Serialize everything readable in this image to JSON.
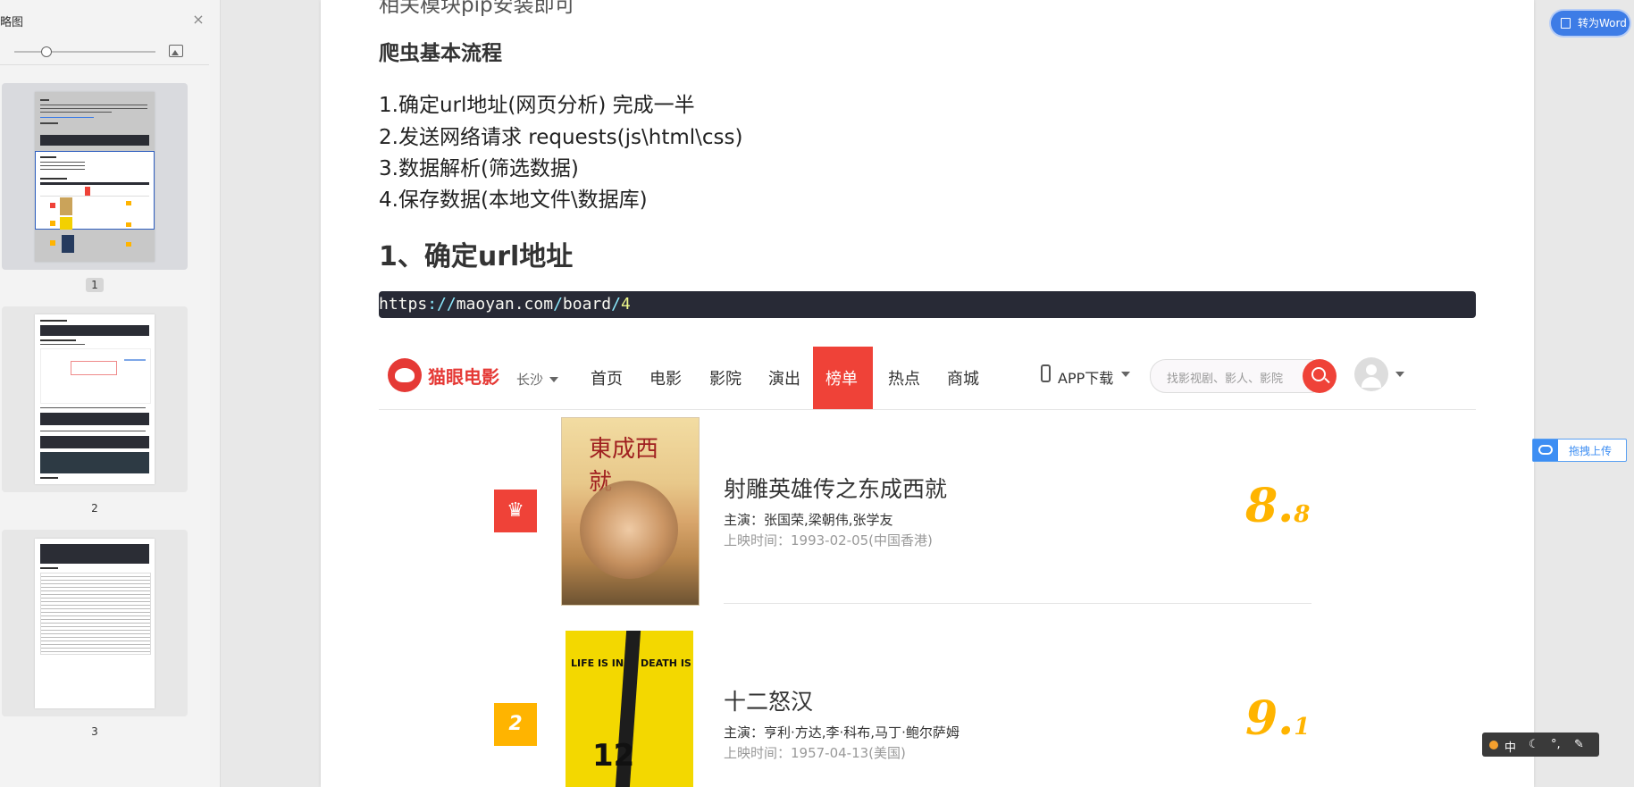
{
  "sidebar": {
    "title": "略图",
    "close_icon": "close-icon",
    "pages": [
      {
        "number": "1",
        "active": true
      },
      {
        "number": "2",
        "active": false
      },
      {
        "number": "3",
        "active": false
      }
    ]
  },
  "document": {
    "cutoff_text": "相关模块pip安装即可",
    "flow_heading": "爬虫基本流程",
    "steps": [
      "1.确定url地址(网页分析) 完成一半",
      "2.发送网络请求 requests(js\\html\\css)",
      "3.数据解析(筛选数据)",
      "4.保存数据(本地文件\\数据库)"
    ],
    "section_heading": "1、确定url地址",
    "code_url": {
      "scheme": "https",
      "sep1": "://",
      "host": "maoyan.com",
      "sep2": "/",
      "path": "board",
      "sep3": "/",
      "num": "4"
    }
  },
  "maoyan": {
    "brand": "猫眼电影",
    "city": "长沙",
    "nav": [
      "首页",
      "电影",
      "影院",
      "演出",
      "榜单",
      "热点",
      "商城"
    ],
    "active_nav": "榜单",
    "app_download": "APP下载",
    "search_placeholder": "找影视剧、影人、影院",
    "movies": [
      {
        "rank": "♛",
        "rank_color": "#ef4238",
        "title": "射雕英雄传之东成西就",
        "stars": "主演：张国荣,梁朝伟,张学友",
        "release": "上映时间：1993-02-05(中国香港)",
        "score_int": "8.",
        "score_dec": "8"
      },
      {
        "rank": "2",
        "rank_color": "#ffb400",
        "title": "十二怒汉",
        "stars": "主演：亨利·方达,李·科布,马丁·鲍尔萨姆",
        "release": "上映时间：1957-04-13(美国)",
        "score_int": "9.",
        "score_dec": "1"
      }
    ]
  },
  "toolbar": {
    "to_word": "转为Word",
    "drag_upload": "拖拽上传"
  },
  "ime": {
    "lang": "中"
  }
}
